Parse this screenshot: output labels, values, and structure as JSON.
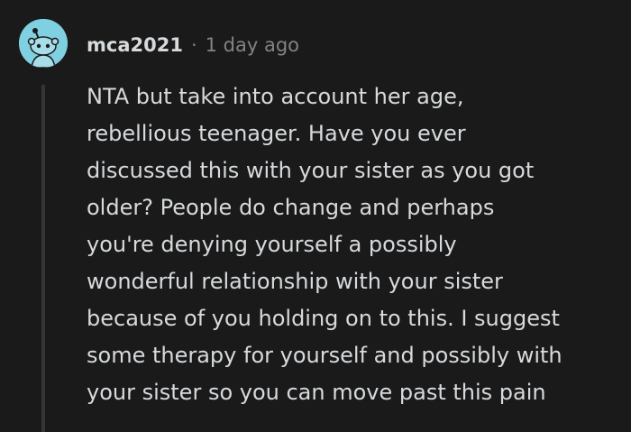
{
  "comment": {
    "author": "mca2021",
    "separator": "·",
    "timestamp": "1 day ago",
    "avatar_icon": "snoo-avatar-icon",
    "avatar_color": "#7fd1e1",
    "body_lines": [
      "NTA but take into account her age,",
      "rebellious teenager. Have you ever",
      "discussed this with your sister as you got",
      "older? People do change and perhaps",
      "you're denying yourself a possibly",
      "wonderful relationship with your sister",
      "because of you holding on to this. I suggest",
      "some therapy for yourself and possibly with",
      "your sister so you can move past this pain"
    ]
  },
  "colors": {
    "background": "#1a1a1b",
    "text": "#d7dadc",
    "muted": "#818384",
    "thread_line": "#343536"
  }
}
